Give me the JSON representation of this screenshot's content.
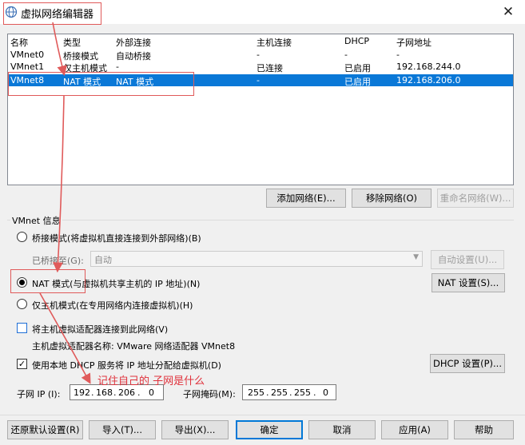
{
  "window": {
    "title": "虚拟网络编辑器",
    "close_symbol": "✕"
  },
  "table": {
    "columns": [
      "名称",
      "类型",
      "外部连接",
      "主机连接",
      "DHCP",
      "子网地址"
    ],
    "rows": [
      {
        "name": "VMnet0",
        "type": "桥接模式",
        "external": "自动桥接",
        "host": "-",
        "dhcp": "-",
        "subnet": "-"
      },
      {
        "name": "VMnet1",
        "type": "仅主机模式",
        "external": "-",
        "host": "已连接",
        "dhcp": "已启用",
        "subnet": "192.168.244.0"
      },
      {
        "name": "VMnet8",
        "type": "NAT 模式",
        "external": "NAT 模式",
        "host": "-",
        "dhcp": "已启用",
        "subnet": "192.168.206.0",
        "selected": true
      }
    ]
  },
  "table_buttons": {
    "add": "添加网络(E)...",
    "remove": "移除网络(O)",
    "rename": "重命名网络(W)..."
  },
  "vmnet_info": {
    "label": "VMnet 信息",
    "bridged_radio": "桥接模式(将虚拟机直接连接到外部网络)(B)",
    "bridged_to_label": "已桥接至(G):",
    "bridged_to_value": "自动",
    "auto_settings": "自动设置(U)...",
    "nat_radio": "NAT 模式(与虚拟机共享主机的 IP 地址)(N)",
    "nat_settings": "NAT 设置(S)...",
    "hostonly_radio": "仅主机模式(在专用网络内连接虚拟机)(H)",
    "connect_adapter": "将主机虚拟适配器连接到此网络(V)",
    "adapter_name": "主机虚拟适配器名称: VMware 网络适配器 VMnet8",
    "use_dhcp": "使用本地 DHCP 服务将 IP 地址分配给虚拟机(D)",
    "dhcp_settings": "DHCP 设置(P)...",
    "subnet_ip_label": "子网 IP (I):",
    "subnet_ip": [
      "192",
      "168",
      "206",
      "0"
    ],
    "subnet_mask_label": "子网掩码(M):",
    "subnet_mask": [
      "255",
      "255",
      "255",
      "0"
    ]
  },
  "annotation": {
    "text": "记住自己的 子网是什么",
    "color": "#e0323c"
  },
  "footer": {
    "restore": "还原默认设置(R)",
    "import": "导入(T)...",
    "export": "导出(X)...",
    "ok": "确定",
    "cancel": "取消",
    "apply": "应用(A)",
    "help": "帮助"
  },
  "colors": {
    "selection": "#0a78d7",
    "accent_blue": "#0078d7"
  }
}
